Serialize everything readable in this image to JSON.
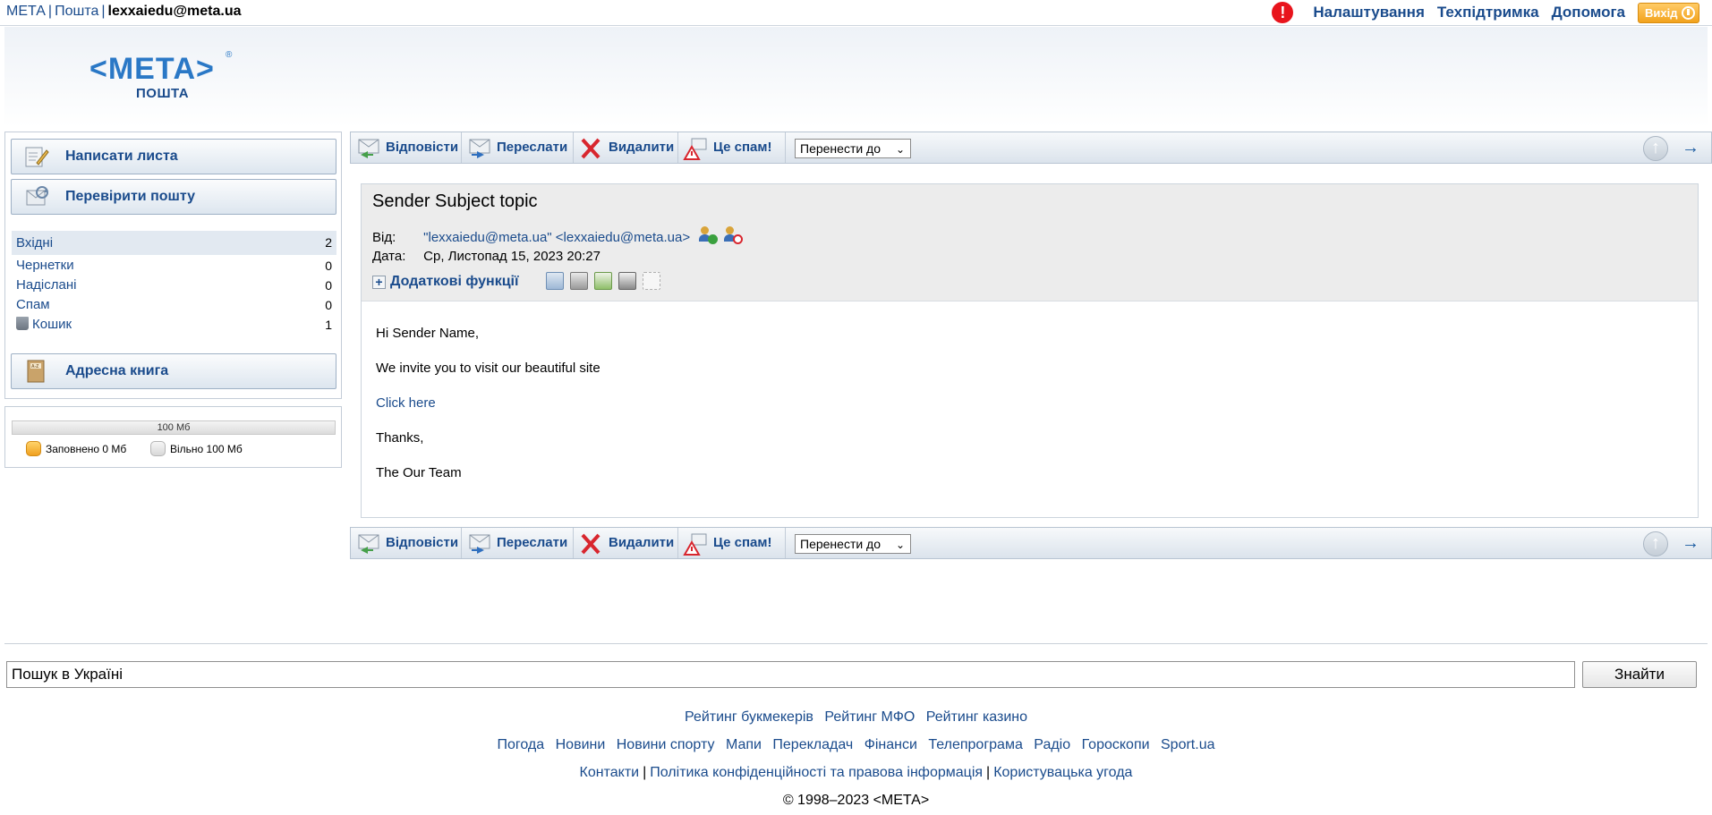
{
  "topbar": {
    "brand": "МЕТА",
    "mail": "Пошта",
    "user": "lexxaiedu@meta.ua",
    "links": [
      "Налаштування",
      "Техпідтримка",
      "Допомога"
    ],
    "exit_label": "Вихід"
  },
  "logo": {
    "line1": "<МЕТА>",
    "line2": "ПОШТА"
  },
  "sidebar": {
    "compose": "Написати листа",
    "check": "Перевірити пошту",
    "folders": [
      {
        "label": "Вхідні",
        "count": "2"
      },
      {
        "label": "Чернетки",
        "count": "0"
      },
      {
        "label": "Надіслані",
        "count": "0"
      },
      {
        "label": "Спам",
        "count": "0"
      },
      {
        "label": "Кошик",
        "count": "1"
      }
    ],
    "addressbook": "Адресна книга"
  },
  "quota": {
    "total": "100 Мб",
    "used": "Заповнено 0 Мб",
    "free": "Вільно 100 Мб",
    "used_fraction": 0
  },
  "toolbar": {
    "reply": "Відповісти",
    "forward": "Переслати",
    "delete": "Видалити",
    "spam": "Це спам!",
    "move": "Перенести до"
  },
  "message": {
    "subject": "Sender Subject topic",
    "from_label": "Від:",
    "from_value": "\"lexxaiedu@meta.ua\" <lexxaiedu@meta.ua>",
    "date_label": "Дата:",
    "date_value": "Ср, Листопад 15, 2023 20:27",
    "extra": "Додаткові функції",
    "body": {
      "greeting": "Hi Sender Name,",
      "line1": "We invite you to visit our beautiful site",
      "link": "Click here",
      "thanks": "Thanks,",
      "sign": "The Our Team"
    }
  },
  "search": {
    "value": "Пошук в Україні",
    "button": "Знайти"
  },
  "footer": {
    "row1": [
      "Рейтинг букмекерів",
      "Рейтинг МФО",
      "Рейтинг казино"
    ],
    "row2": [
      "Погода",
      "Новини",
      "Новини спорту",
      "Мапи",
      "Перекладач",
      "Фінанси",
      "Телепрограма",
      "Радіо",
      "Гороскопи",
      "Sport.ua"
    ],
    "row3": [
      "Контакти",
      "Політика конфіденційності та правова інформація",
      "Користувацька угода"
    ],
    "copyright": "© 1998–2023 <МЕТА>"
  }
}
